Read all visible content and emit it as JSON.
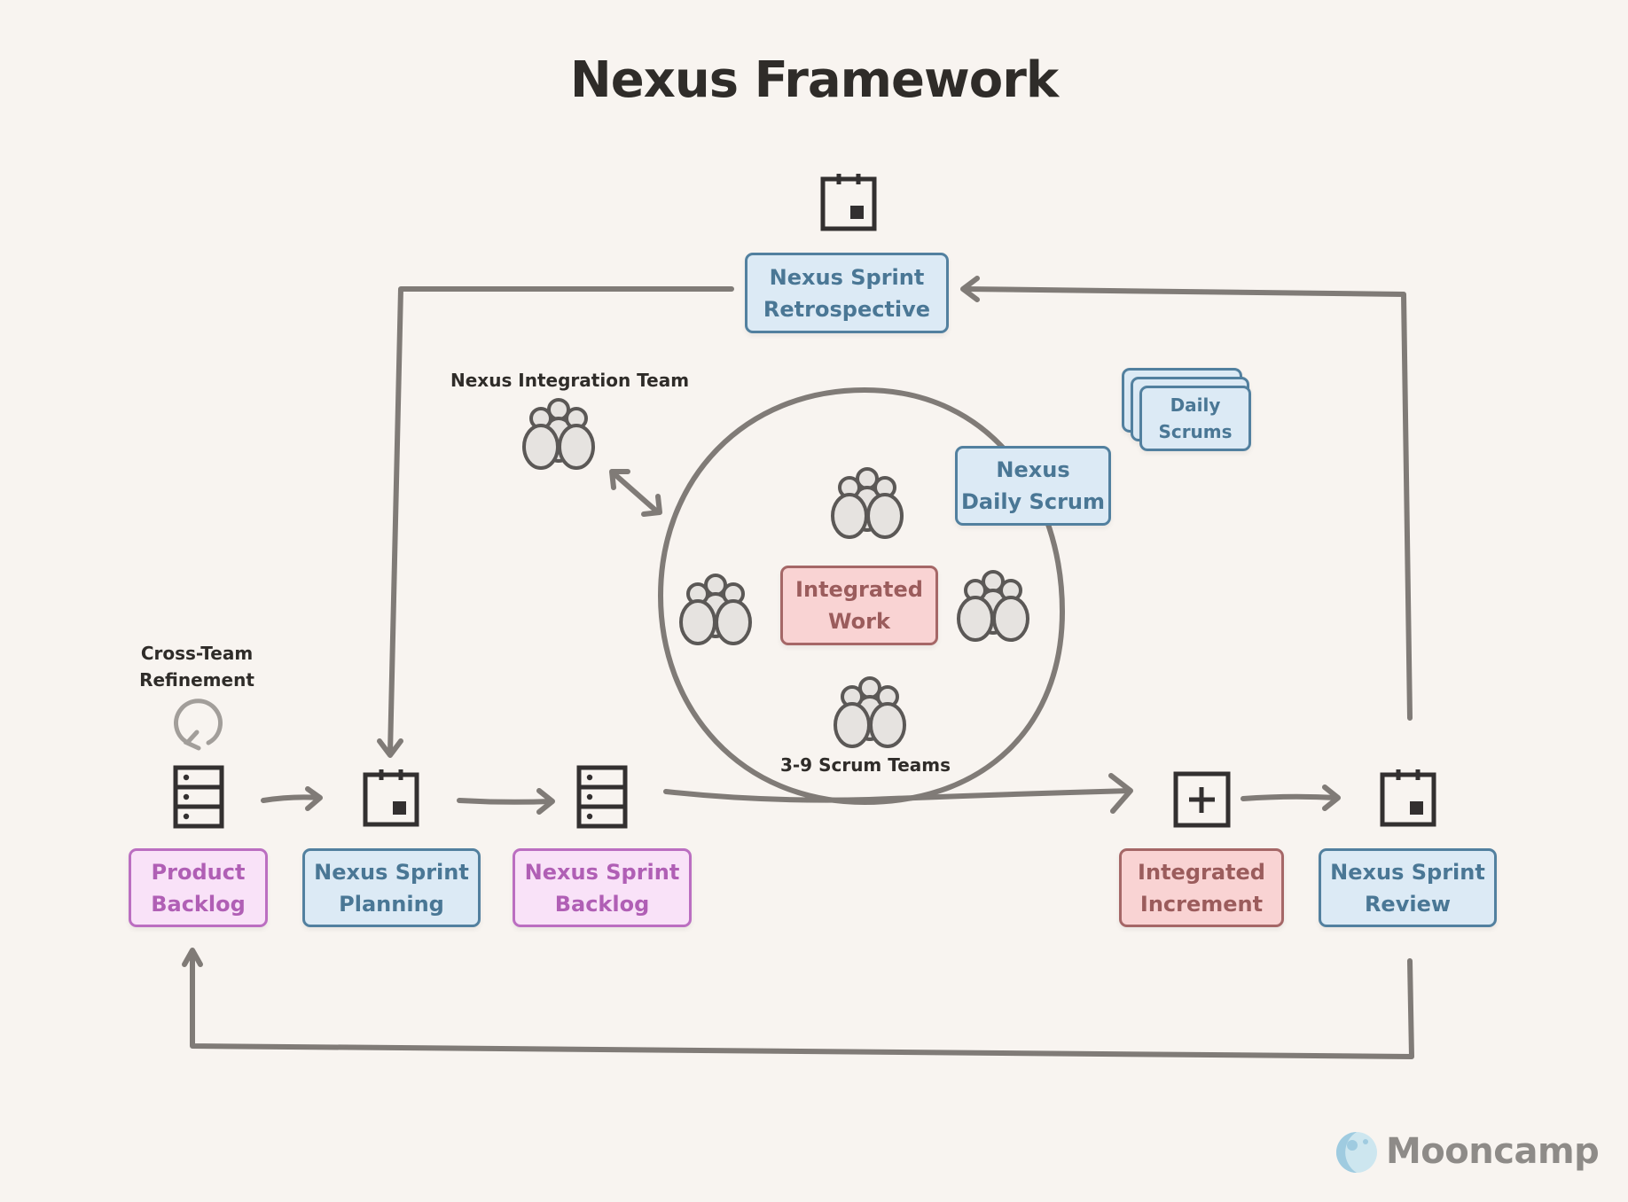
{
  "title": "Nexus Framework",
  "colors": {
    "background": "#f8f4f0",
    "connector": "#807b77",
    "icon_dark": "#333030",
    "blue_fill": "#dceaf5",
    "blue_border": "#52809f",
    "pink_fill": "#f9e2f8",
    "pink_border": "#bb6ec1",
    "red_fill": "#f9d3d3",
    "red_border": "#a56767"
  },
  "events": {
    "retrospective": {
      "line1": "Nexus Sprint",
      "line2": "Retrospective",
      "icon": "calendar-icon"
    },
    "planning": {
      "line1": "Nexus Sprint",
      "line2": "Planning",
      "icon": "calendar-icon"
    },
    "review": {
      "line1": "Nexus Sprint",
      "line2": "Review",
      "icon": "calendar-icon"
    },
    "nexus_daily_scrum": {
      "line1": "Nexus",
      "line2": "Daily Scrum"
    },
    "daily_scrums": {
      "line1": "Daily",
      "line2": "Scrums"
    }
  },
  "artifacts": {
    "product_backlog": {
      "line1": "Product",
      "line2": "Backlog",
      "icon": "backlog-stack-icon"
    },
    "sprint_backlog": {
      "line1": "Nexus Sprint",
      "line2": "Backlog",
      "icon": "backlog-stack-icon"
    },
    "integrated_increment": {
      "line1": "Integrated",
      "line2": "Increment",
      "icon": "plus-square-icon"
    },
    "integrated_work": {
      "line1": "Integrated",
      "line2": "Work"
    }
  },
  "labels": {
    "integration_team": "Nexus Integration Team",
    "scrum_teams": "3-9 Scrum Teams",
    "refinement_line1": "Cross-Team",
    "refinement_line2": "Refinement"
  },
  "brand": {
    "name": "Mooncamp",
    "icon": "moon-logo-icon"
  }
}
